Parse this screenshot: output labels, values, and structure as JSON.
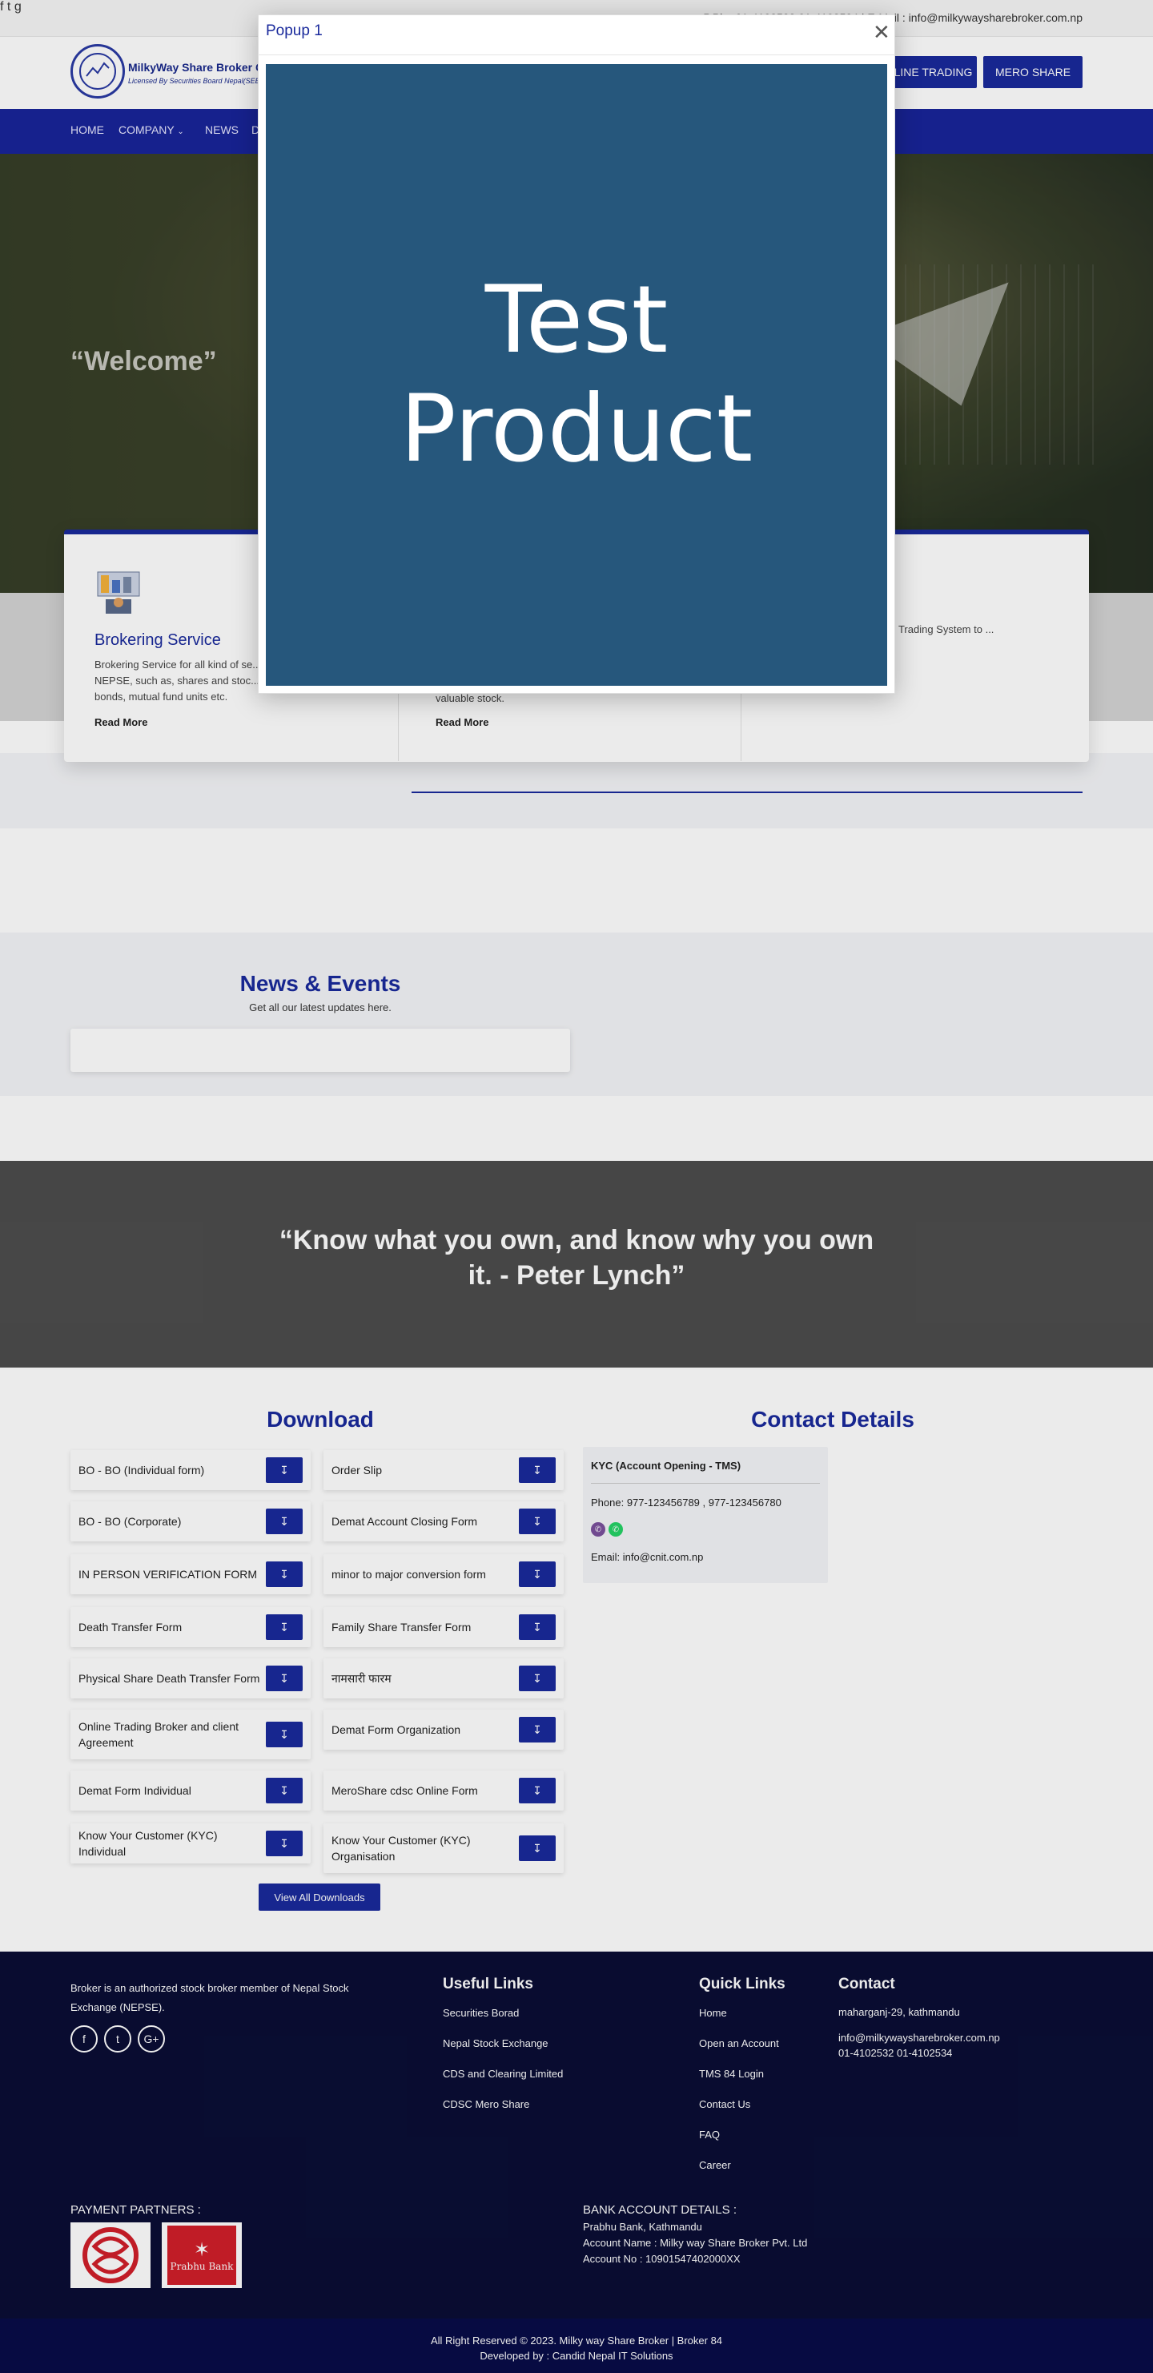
{
  "topbar": {
    "social_icons": [
      "facebook-icon",
      "twitter-icon",
      "google-plus-icon"
    ],
    "contact_text": "P.Ph : 01-4102532 01-4102534 | E-Mail : info@milkywaysharebroker.com.np"
  },
  "header": {
    "logo_name": "MilkyWay Share Broker Co.",
    "logo_sub": "Licensed By Securities Board Nepal(SEBON)",
    "online_trading": "ONLINE TRADING",
    "mero_share": "MERO SHARE"
  },
  "nav": {
    "home": "HOME",
    "company": "COMPANY",
    "news": "NEWS",
    "more": "D"
  },
  "hero": {
    "title": "“Welcome”"
  },
  "services": [
    {
      "title": "Brokering Service",
      "desc": "Brokering Service for all kind of se... NEPSE, such as, shares and stoc... bonds, mutual fund units etc.",
      "read_more": "Read More"
    },
    {
      "title": "",
      "desc": "valuable stock.",
      "read_more": "Read More"
    },
    {
      "title": "",
      "desc": "in for the Trading System to ...",
      "read_more": ""
    }
  ],
  "news": {
    "title": "News & Events",
    "subtitle": "Get all our latest updates here."
  },
  "quote": {
    "text": "“Know what you own, and know why you own it. - Peter Lynch”"
  },
  "download": {
    "title": "Download",
    "items_left": [
      "BO - BO (Individual form)",
      "BO - BO (Corporate)",
      "IN PERSON VERIFICATION FORM",
      "Death Transfer Form",
      "Physical Share Death Transfer Form",
      "Online Trading Broker and client Agreement",
      "Demat Form Individual",
      "Know Your Customer (KYC) Individual"
    ],
    "items_right": [
      "Order Slip",
      "Demat Account Closing Form",
      "minor to major conversion form",
      "Family Share Transfer Form",
      "नामसारी फारम",
      "Demat Form Organization",
      "MeroShare cdsc Online Form",
      "Know Your Customer (KYC) Organisation"
    ],
    "view_all": "View All Downloads"
  },
  "contact": {
    "title": "Contact Details",
    "heading": "KYC (Account Opening - TMS)",
    "phone": "Phone: 977-123456789 , 977-123456780",
    "email": "Email: info@cnit.com.np"
  },
  "footer": {
    "about": "Broker is an authorized stock broker member of Nepal Stock Exchange (NEPSE).",
    "useful_title": "Useful Links",
    "useful_links": [
      "Securities Borad",
      "Nepal Stock Exchange",
      "CDS and Clearing Limited",
      "CDSC Mero Share"
    ],
    "quick_title": "Quick Links",
    "quick_links": [
      "Home",
      "Open an Account",
      "TMS 84 Login",
      "Contact Us",
      "FAQ",
      "Career"
    ],
    "contact_title": "Contact",
    "address": "maharganj-29, kathmandu",
    "email": "info@milkywaysharebroker.com.np",
    "phones": "01-4102532  01-4102534",
    "payment_title": "PAYMENT PARTNERS :",
    "bank_title": "BANK ACCOUNT DETAILS :",
    "bank_name": "Prabhu Bank, Kathmandu",
    "account_name": "Account Name : Milky way Share Broker Pvt. Ltd",
    "account_no": "Account No : 10901547402000XX",
    "prabhu_label": "Prabhu Bank",
    "copyright": "All Right Reserved © 2023. Milky way Share Broker | Broker 84",
    "developed": "Developed by : Candid Nepal IT Solutions"
  },
  "popup": {
    "title": "Popup 1",
    "image_line1": "Test",
    "image_line2": "Product"
  },
  "colors": {
    "brand": "#1a2a9c",
    "footer": "#0a0e35",
    "popup_image": "#26577c"
  }
}
